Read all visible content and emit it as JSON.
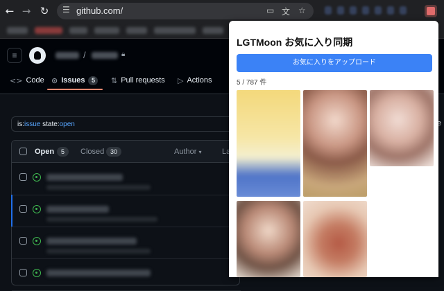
{
  "browser": {
    "url": "github.com/",
    "back_icon": "arrow-left-icon",
    "forward_icon": "arrow-right-icon",
    "reload_icon": "reload-icon"
  },
  "repo": {
    "tabs": [
      {
        "label": "Code",
        "icon": "code-icon"
      },
      {
        "label": "Issues",
        "icon": "issue-opened-icon",
        "count": "5"
      },
      {
        "label": "Pull requests",
        "icon": "git-pull-request-icon"
      },
      {
        "label": "Actions",
        "icon": "play-icon"
      }
    ]
  },
  "issues": {
    "filter_prefix": "is:",
    "filter_issue": "issue",
    "filter_mid": " state:",
    "filter_open": "open",
    "open_label": "Open",
    "open_count": "5",
    "closed_label": "Closed",
    "closed_count": "30",
    "author_label": "Author",
    "next_label": "La"
  },
  "edge_text": "e",
  "popup": {
    "title": "LGTMoon お気に入り同期",
    "upload_button": "お気に入りをアップロード",
    "count": "5 / 787 件",
    "accent": "#3b82f6"
  }
}
